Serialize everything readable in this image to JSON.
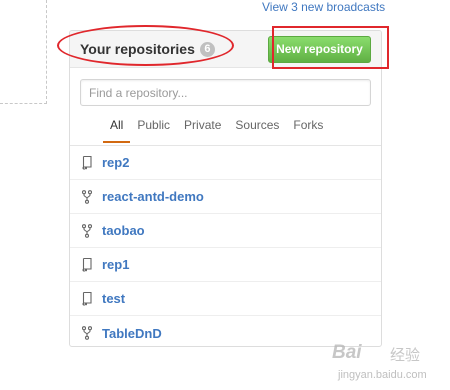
{
  "broadcasts_link": "View 3 new broadcasts",
  "repositories_panel": {
    "title": "Your repositories",
    "count": "6",
    "new_button_label": "New repository",
    "search": {
      "placeholder": "Find a repository...",
      "value": ""
    },
    "filter_tabs": [
      {
        "label": "All",
        "selected": true
      },
      {
        "label": "Public",
        "selected": false
      },
      {
        "label": "Private",
        "selected": false
      },
      {
        "label": "Sources",
        "selected": false
      },
      {
        "label": "Forks",
        "selected": false
      }
    ],
    "repositories": [
      {
        "name": "rep2",
        "icon": "repo-icon"
      },
      {
        "name": "react-antd-demo",
        "icon": "repo-forked-icon"
      },
      {
        "name": "taobao",
        "icon": "repo-forked-icon"
      },
      {
        "name": "rep1",
        "icon": "repo-icon"
      },
      {
        "name": "test",
        "icon": "repo-icon"
      },
      {
        "name": "TableDnD",
        "icon": "repo-forked-icon"
      }
    ]
  },
  "annotation_color": "#e0272c",
  "accent_colors": {
    "link": "#4078c0",
    "button_green": "#60b044",
    "tab_underline": "#d26911"
  },
  "watermark": {
    "brand": "Bai",
    "brand_cn": "经验",
    "url": "jingyan.baidu.com"
  }
}
